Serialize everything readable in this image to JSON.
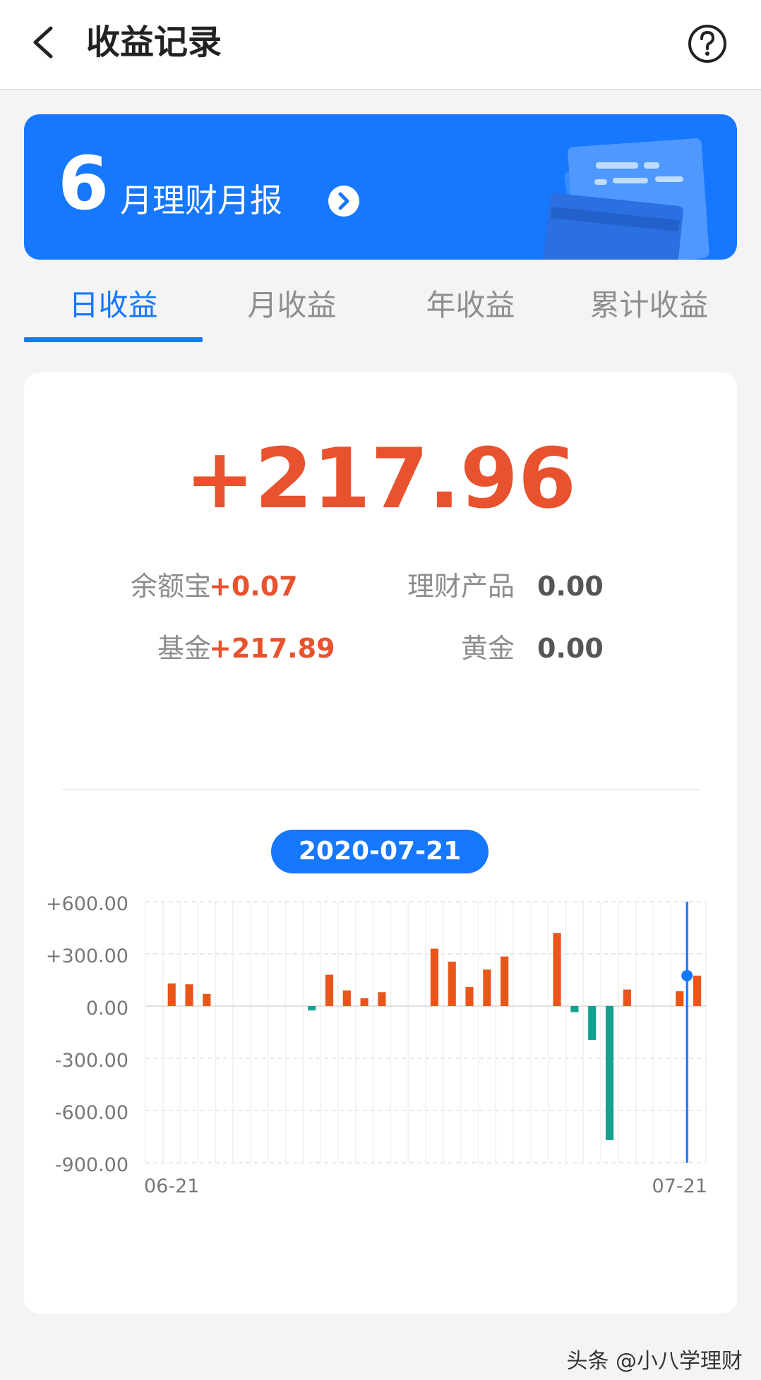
{
  "header": {
    "title": "收益记录",
    "back_icon": "back-arrow-icon",
    "help_icon": "question-circle-icon"
  },
  "banner": {
    "month": "6",
    "text": "月理财月报",
    "arrow_icon": "chevron-right-circle-icon",
    "color": "#1677ff"
  },
  "tabs": [
    {
      "label": "日收益",
      "active": true
    },
    {
      "label": "月收益",
      "active": false
    },
    {
      "label": "年收益",
      "active": false
    },
    {
      "label": "累计收益",
      "active": false
    }
  ],
  "summary": {
    "total": "+217.96",
    "items": [
      {
        "label": "余额宝",
        "value": "+0.07"
      },
      {
        "label": "理财产品",
        "value": "0.00"
      },
      {
        "label": "基金",
        "value": "+217.89"
      },
      {
        "label": "黄金",
        "value": "0.00"
      }
    ]
  },
  "selected_date": "2020-07-21",
  "chart_data": {
    "type": "bar",
    "title": "",
    "xlabel": "",
    "ylabel": "",
    "ylim": [
      -900,
      600
    ],
    "yticks": [
      "+600.00",
      "+300.00",
      "0.00",
      "-300.00",
      "-600.00",
      "-900.00"
    ],
    "ytick_values": [
      600,
      300,
      0,
      -300,
      -600,
      -900
    ],
    "x_tick_labels": [
      {
        "index": 1,
        "label": "06-21"
      },
      {
        "index": 30,
        "label": "07-21"
      }
    ],
    "grid": true,
    "positive_color": "#e8561a",
    "negative_color": "#12a28f",
    "cursor_color": "#1677ff",
    "selected_index": 30,
    "values": [
      0,
      130,
      125,
      70,
      0,
      0,
      0,
      0,
      0,
      -25,
      180,
      90,
      45,
      80,
      0,
      0,
      330,
      255,
      110,
      210,
      285,
      0,
      0,
      420,
      -35,
      -195,
      -770,
      95,
      0,
      0,
      85,
      175
    ]
  },
  "watermark": "头条 @小八学理财"
}
